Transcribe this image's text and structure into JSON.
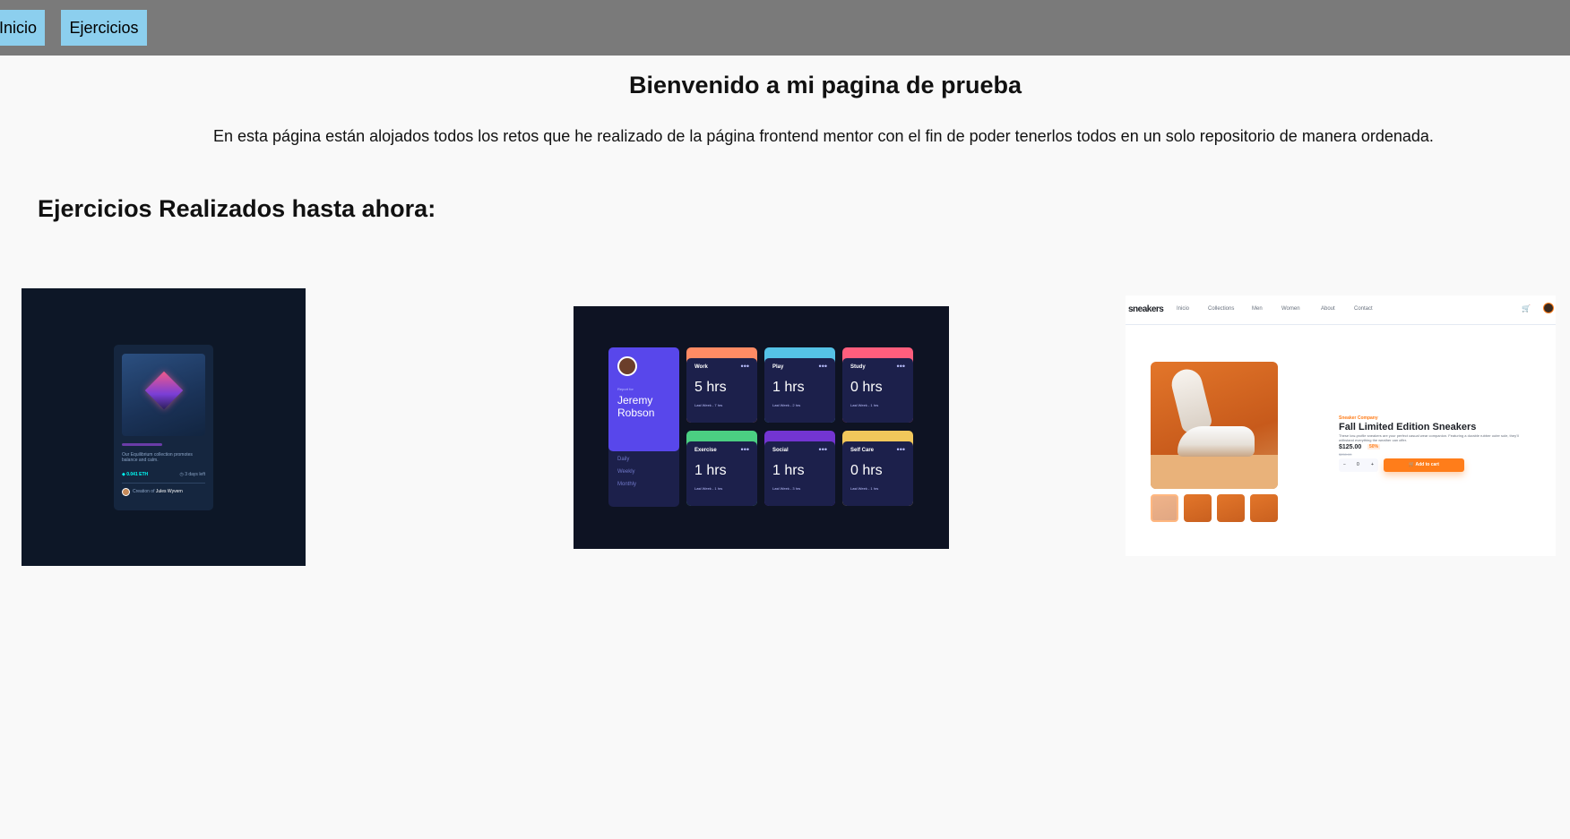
{
  "nav": {
    "inicio_label": "Inicio",
    "ejercicios_label": "Ejercicios"
  },
  "main": {
    "title": "Bienvenido a mi pagina de prueba",
    "intro": "En esta página están alojados todos los retos que he realizado de la página frontend mentor con el fin de poder tenerlos todos en un solo repositorio de manera ordenada.",
    "section_title": "Ejercicios Realizados hasta ahora:"
  },
  "thumbnails": {
    "nft": {
      "description": "Our Equilibrium collection promotes balance and calm.",
      "eth": "◆ 0.041 ETH",
      "days": "◷ 3 days left",
      "creator_prefix": "Creation of",
      "creator_name": "Jules Wyvern"
    },
    "dashboard": {
      "report_for": "Report for",
      "name": "Jeremy Robson",
      "periods": [
        "Daily",
        "Weekly",
        "Monthly"
      ],
      "cards": [
        {
          "label": "Work",
          "hours": "5 hrs",
          "last": "Last Week - 7 hrs",
          "color": "#ff8b64"
        },
        {
          "label": "Play",
          "hours": "1 hrs",
          "last": "Last Week - 2 hrs",
          "color": "#55c2e6"
        },
        {
          "label": "Study",
          "hours": "0 hrs",
          "last": "Last Week - 1 hrs",
          "color": "#ff5e7d"
        },
        {
          "label": "Exercise",
          "hours": "1 hrs",
          "last": "Last Week - 1 hrs",
          "color": "#4bcf82"
        },
        {
          "label": "Social",
          "hours": "1 hrs",
          "last": "Last Week - 3 hrs",
          "color": "#7335d2"
        },
        {
          "label": "Self Care",
          "hours": "0 hrs",
          "last": "Last Week - 1 hrs",
          "color": "#f1c75b"
        }
      ],
      "dots": "•••"
    },
    "sneakers": {
      "logo": "sneakers",
      "nav_items": [
        "Inicio",
        "Collections",
        "Men",
        "Women",
        "About",
        "Contact"
      ],
      "cart_icon": "cart-icon",
      "company": "Sneaker Company",
      "product_title": "Fall Limited Edition Sneakers",
      "description": "These low-profile sneakers are your perfect casual wear companion. Featuring a durable rubber outer sole, they'll withstand everything the weather can offer.",
      "price": "$125.00",
      "discount": "50%",
      "old_price": "$250.00",
      "qty_minus": "−",
      "qty_value": "0",
      "qty_plus": "+",
      "add_to_cart": "🛒 Add to cart"
    }
  }
}
